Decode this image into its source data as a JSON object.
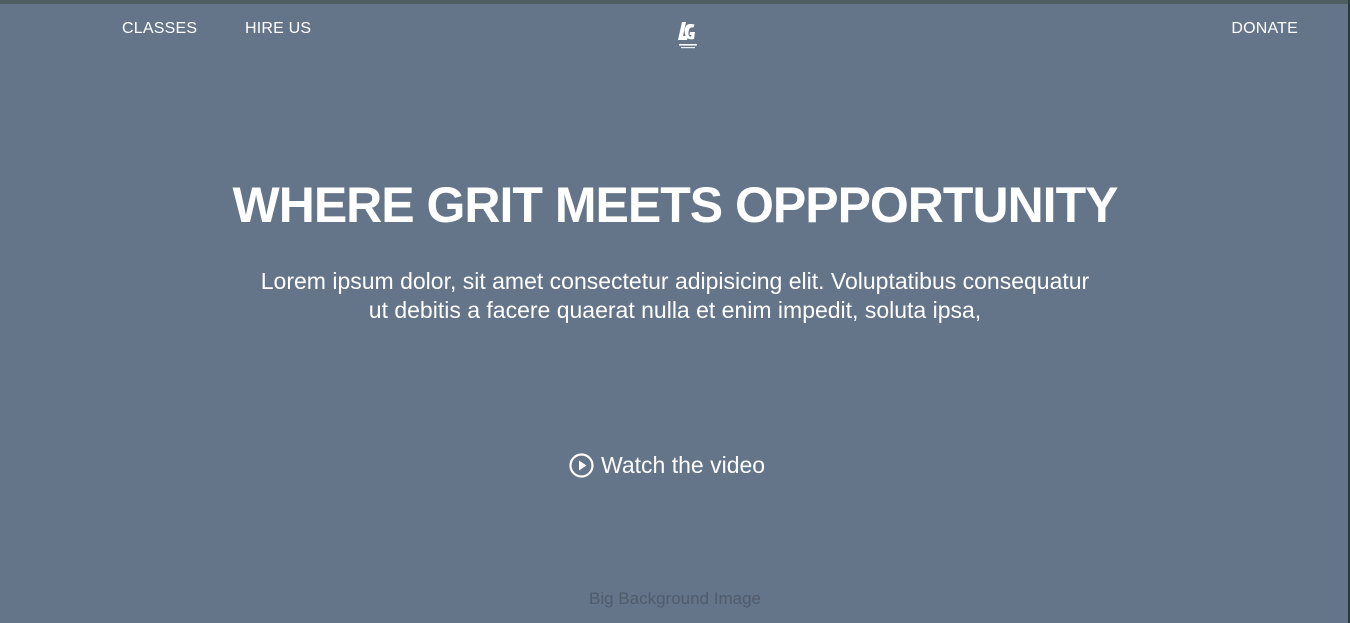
{
  "nav": {
    "left_items": [
      {
        "label": "CLASSES"
      },
      {
        "label": "HIRE US"
      }
    ],
    "right_items": [
      {
        "label": "DONATE"
      }
    ],
    "logo_text": "LG"
  },
  "hero": {
    "title": "WHERE GRIT MEETS OPPPORTUNITY",
    "body": "Lorem ipsum dolor, sit amet consectetur adipisicing elit. Voluptatibus consequatur ut debitis a facere quaerat nulla et enim impedit, soluta ipsa,",
    "video_link": "Watch the video",
    "video_icon": "play-circle-icon"
  },
  "background_caption": "Big Background Image",
  "colors": {
    "background": "#647489",
    "top_strip": "#4f5f60",
    "text": "#ffffff",
    "caption": "#4f5c6b"
  }
}
